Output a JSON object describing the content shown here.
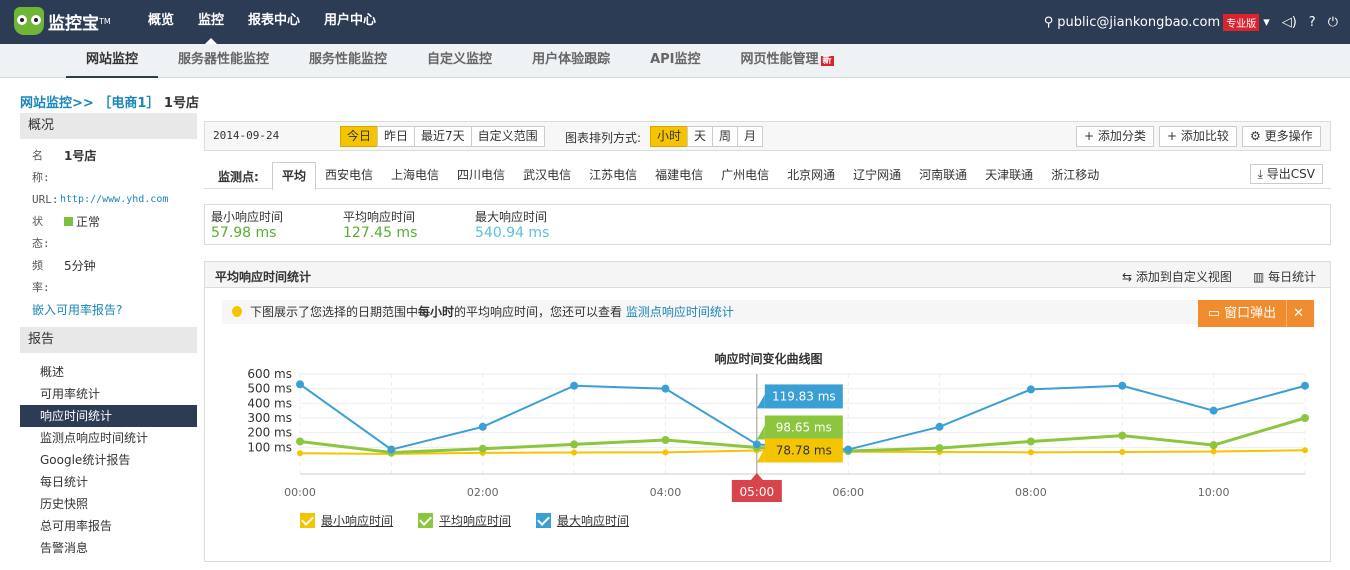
{
  "header": {
    "logo": "监控宝",
    "tm": "TM",
    "nav": [
      "概览",
      "监控",
      "报表中心",
      "用户中心"
    ],
    "active_nav": 1,
    "user": "public@jiankongbao.com",
    "pro": "专业版"
  },
  "subnav": {
    "items": [
      "网站监控",
      "服务器性能监控",
      "服务性能监控",
      "自定义监控",
      "用户体验跟踪",
      "API监控",
      "网页性能管理"
    ],
    "new_badge": "新"
  },
  "breadcrumb": {
    "root": "网站监控>>",
    "group": "［电商1］",
    "site": "1号店"
  },
  "sidebar": {
    "overview_title": "概况",
    "name_label": "名称:",
    "name": "1号店",
    "url_label": "URL:",
    "url": "http://www.yhd.com",
    "status_label": "状态:",
    "status": "正常",
    "freq_label": "频率:",
    "freq": "5分钟",
    "embed": "嵌入可用率报告?",
    "report_title": "报告",
    "menu": [
      "概述",
      "可用率统计",
      "响应时间统计",
      "监测点响应时间统计",
      "Google统计报告",
      "每日统计",
      "历史快照",
      "总可用率报告",
      "告警消息"
    ],
    "menu_active": 2
  },
  "toolbar": {
    "date": "2014-09-24",
    "ranges": [
      "今日",
      "昨日",
      "最近7天",
      "自定义范围"
    ],
    "sort_label": "图表排列方式:",
    "sorts": [
      "小时",
      "天",
      "周",
      "月"
    ],
    "add_category": "添加分类",
    "add_compare": "添加比较",
    "more": "更多操作"
  },
  "probes": {
    "label": "监测点:",
    "items": [
      "平均",
      "西安电信",
      "上海电信",
      "四川电信",
      "武汉电信",
      "江苏电信",
      "福建电信",
      "广州电信",
      "北京网通",
      "辽宁网通",
      "河南联通",
      "天津联通",
      "浙江移动"
    ],
    "export": "导出CSV"
  },
  "stats": [
    {
      "label": "最小响应时间",
      "value": "57.98 ms",
      "color": "#5aae2e"
    },
    {
      "label": "平均响应时间",
      "value": "127.45 ms",
      "color": "#5aae2e"
    },
    {
      "label": "最大响应时间",
      "value": "540.94 ms",
      "color": "#5bc0de"
    }
  ],
  "panel": {
    "title": "平均响应时间统计",
    "add_view": "添加到自定义视图",
    "daily": "每日统计",
    "tip_pre": "下图展示了您选择的日期范围中",
    "tip_bold": "每小时",
    "tip_mid": "的平均响应时间，您还可以查看",
    "tip_link": "监测点响应时间统计",
    "popup": "窗口弹出",
    "close": "✕"
  },
  "chart_data": {
    "type": "line",
    "title": "响应时间变化曲线图",
    "x": [
      "00:00",
      "01:00",
      "02:00",
      "03:00",
      "04:00",
      "05:00",
      "06:00",
      "07:00",
      "08:00",
      "09:00",
      "10:00",
      "11:00"
    ],
    "xticks": [
      "00:00",
      "02:00",
      "04:00",
      "06:00",
      "08:00",
      "10:00"
    ],
    "yticks": [
      "100 ms",
      "200 ms",
      "300 ms",
      "400 ms",
      "500 ms",
      "600 ms"
    ],
    "ylim": [
      0,
      600
    ],
    "series": [
      {
        "name": "最小响应时间",
        "color": "#f5c400",
        "values": [
          60,
          55,
          62,
          65,
          66,
          78.78,
          70,
          68,
          66,
          68,
          72,
          80
        ]
      },
      {
        "name": "平均响应时间",
        "color": "#8cc63f",
        "values": [
          140,
          65,
          90,
          120,
          150,
          98.65,
          75,
          95,
          140,
          180,
          115,
          300
        ]
      },
      {
        "name": "最大响应时间",
        "color": "#3a9fd4",
        "values": [
          530,
          85,
          240,
          520,
          500,
          119.83,
          85,
          240,
          495,
          520,
          350,
          520
        ]
      }
    ],
    "hover": {
      "x": "05:00",
      "labels": [
        "119.83 ms",
        "98.65 ms",
        "78.78 ms"
      ]
    }
  }
}
